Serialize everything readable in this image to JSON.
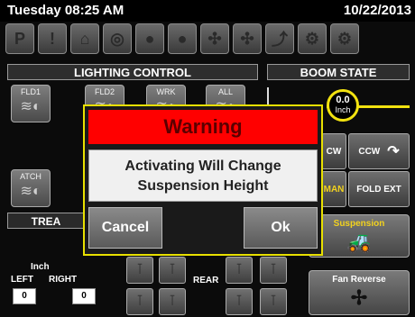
{
  "status_bar": {
    "time": "Tuesday 08:25 AM",
    "date": "10/22/2013"
  },
  "toolbar_icons": [
    "park-icon",
    "warning-icon",
    "boom-icon",
    "tank-icon",
    "pump-icon",
    "pump2-icon",
    "spray-icon",
    "spray2-icon",
    "joystick-icon",
    "fan-icon",
    "settings-icon"
  ],
  "toolbar_glyphs": [
    "P",
    "!",
    "⌂",
    "◎",
    "●",
    "●",
    "✣",
    "✣",
    "⤴",
    "⚙",
    "⚙"
  ],
  "lighting": {
    "title": "LIGHTING CONTROL",
    "buttons": [
      {
        "label": "FLD1",
        "icon": "lamp-icon"
      },
      {
        "label": "FLD2",
        "icon": "lamp-icon"
      },
      {
        "label": "WRK",
        "icon": "lamp-icon"
      },
      {
        "label": "ALL",
        "icon": "lamp-icon"
      }
    ],
    "attach_button": {
      "label": "ATCH",
      "icon": "lamp-icon"
    }
  },
  "boom": {
    "title": "BOOM STATE",
    "gauge_value": "0.0",
    "gauge_unit": "Inch",
    "ccw_left": "CW",
    "ccw_right": "CCW",
    "man": "MAN",
    "fold_ext": "FOLD EXT"
  },
  "treatment": {
    "title": "TREA",
    "inch_label": "Inch",
    "left_label": "LEFT",
    "right_label": "RIGHT",
    "left_value": "0",
    "right_value": "0",
    "rear_label": "REAR"
  },
  "side_buttons": {
    "suspension": "Suspension",
    "fan_reverse": "Fan Reverse"
  },
  "dialog": {
    "title": "Warning",
    "message_line1": "Activating Will Change",
    "message_line2": "Suspension Height",
    "cancel": "Cancel",
    "ok": "Ok"
  },
  "colors": {
    "warning_red": "#ff0000",
    "highlight_yellow": "#f2e210",
    "dialog_border": "#e8e000"
  }
}
